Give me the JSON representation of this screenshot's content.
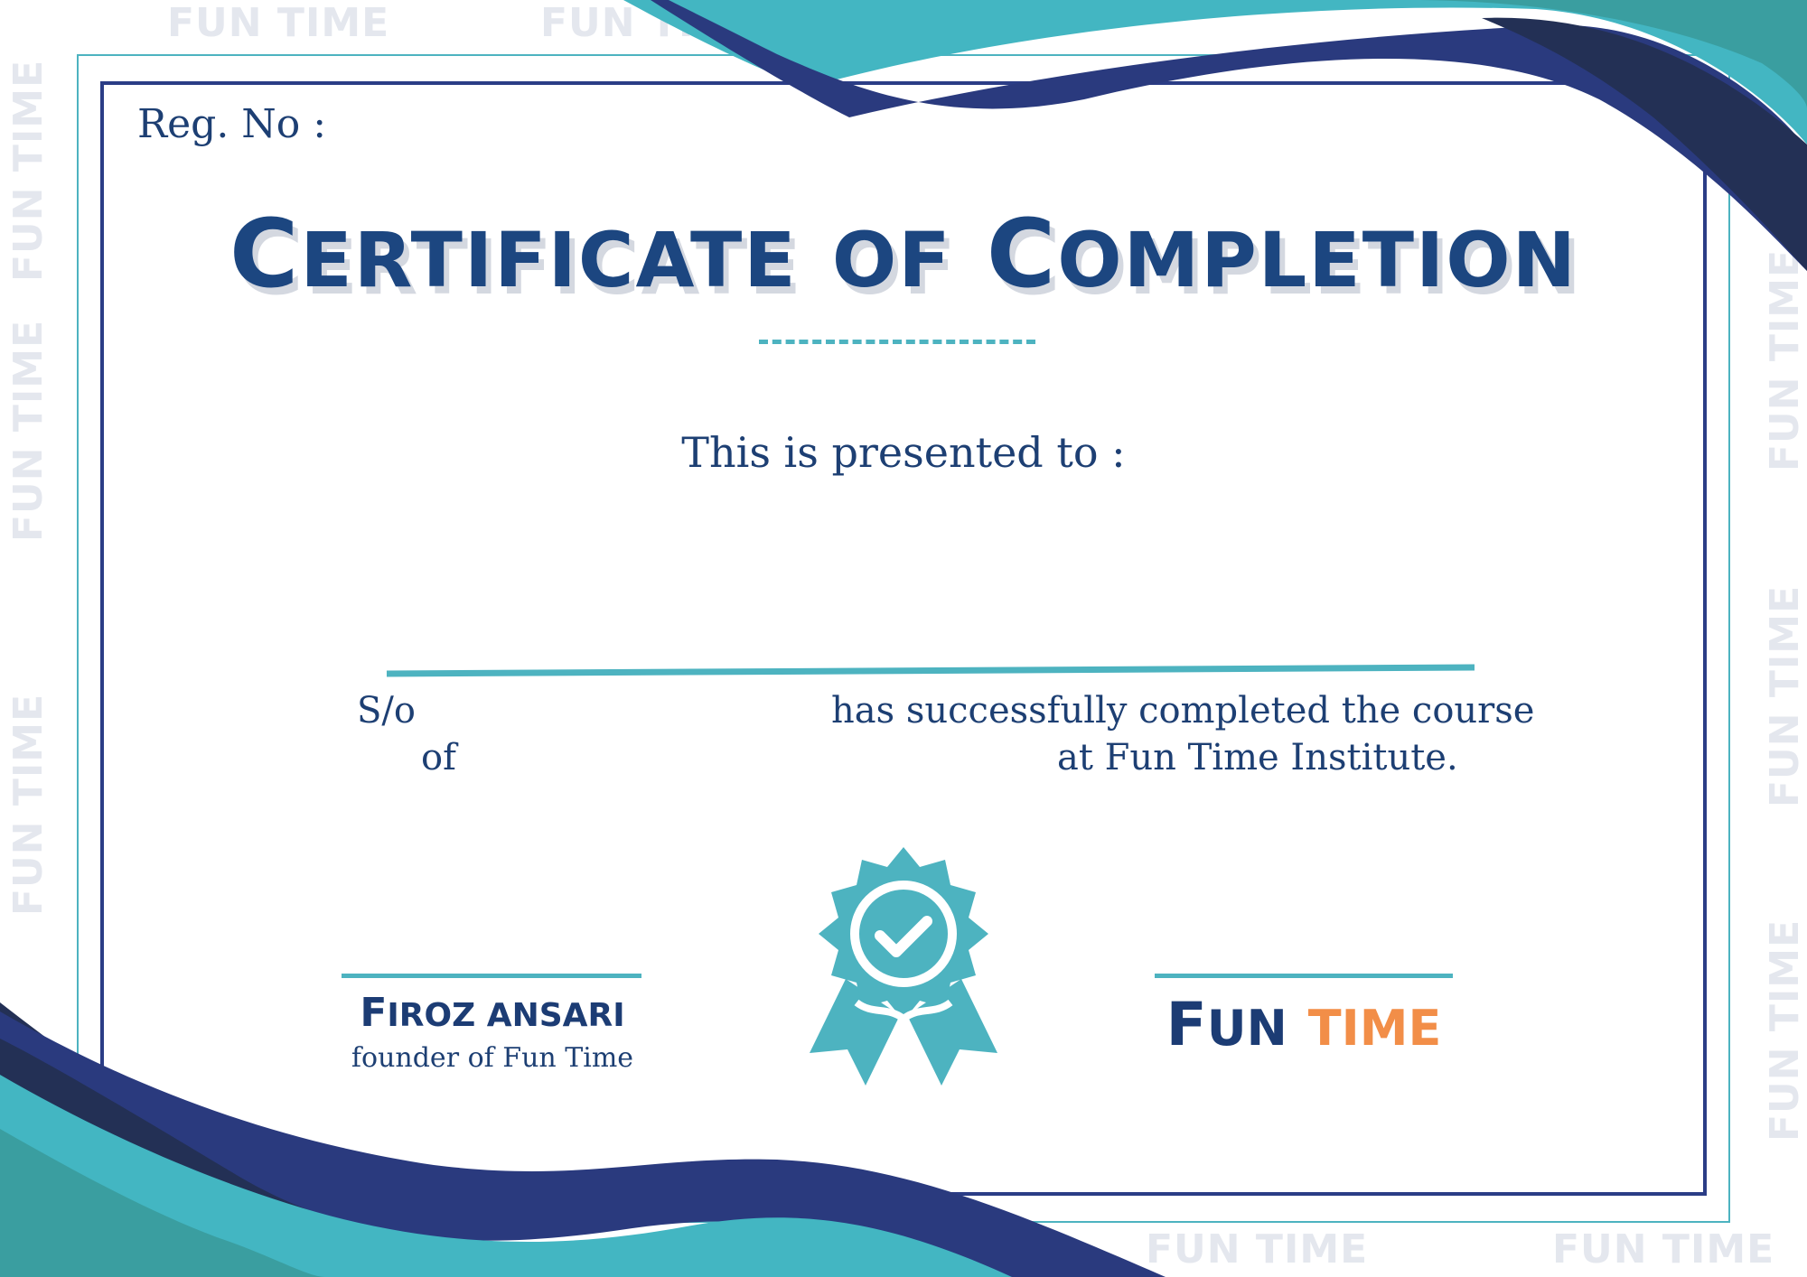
{
  "certificate": {
    "reg_label": "Reg. No :",
    "title_word1_initial": "C",
    "title_word1_rest": "ERTIFICATE",
    "title_word2_initial": "",
    "title_word2_rest": "OF",
    "title_word3_initial": "C",
    "title_word3_rest": "OMPLETION",
    "presented_to": "This is presented to :",
    "son_of": "S/o",
    "completed_text": "has successfully completed the course",
    "of_label": "of",
    "institute_text": "at Fun Time Institute."
  },
  "signature": {
    "name_initial": "F",
    "name_rest": "IROZ ANSARI",
    "role": "founder of Fun Time"
  },
  "brand": {
    "word1_initial": "F",
    "word1_rest": "UN",
    "word2": "TIME"
  },
  "watermark": {
    "text": "FUN TIME"
  },
  "colors": {
    "navy": "#1c4680",
    "teal": "#4db3c0",
    "orange": "#f28e48",
    "deep_blue": "#2b3d86"
  },
  "icons": {
    "badge": "award-ribbon-check-icon"
  }
}
